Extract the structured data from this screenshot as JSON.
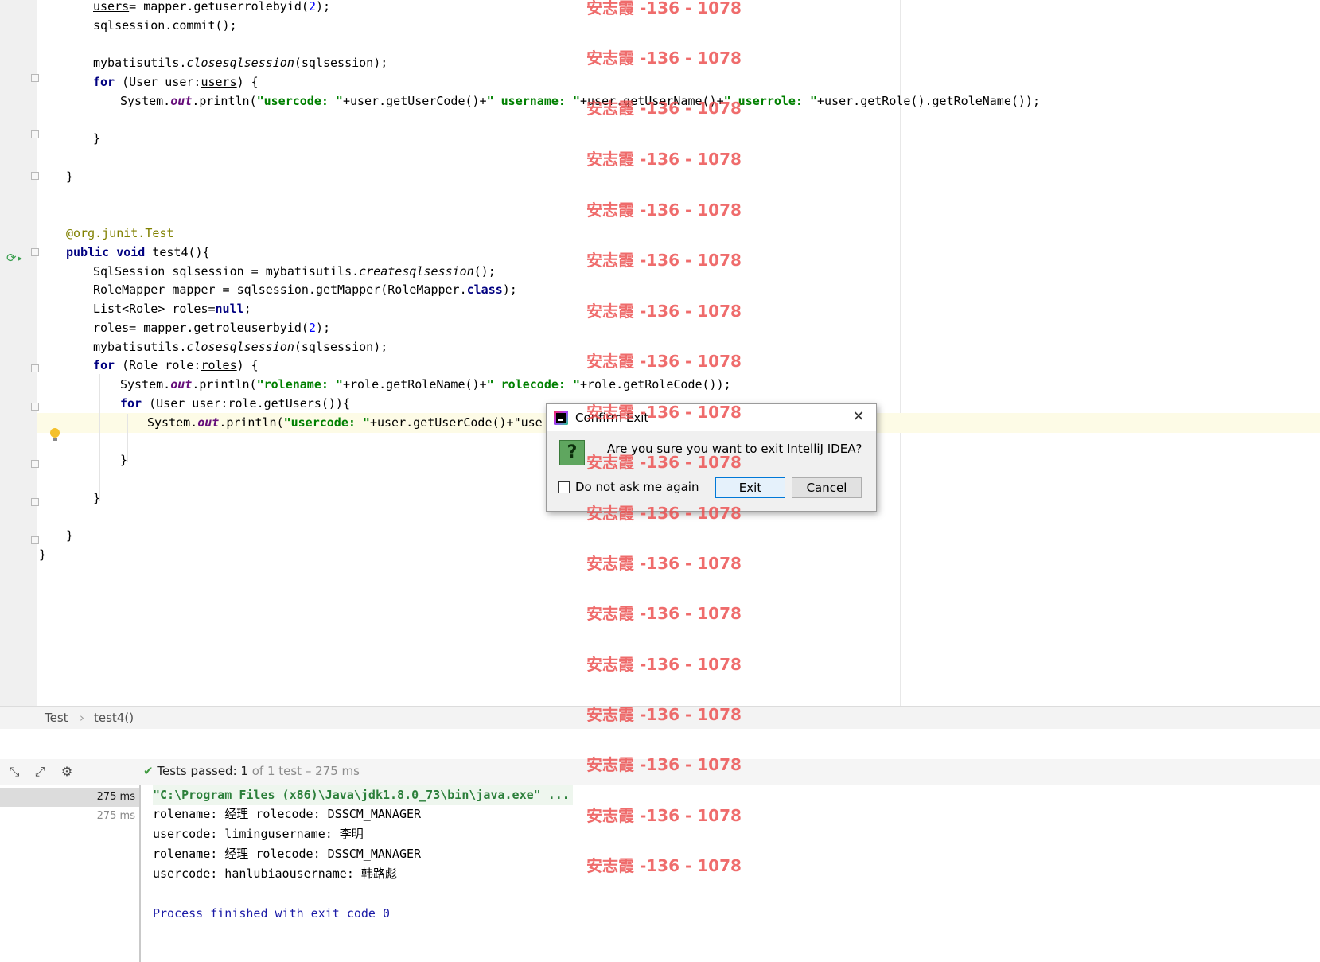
{
  "editor": {
    "lines": [
      [
        {
          "t": "users",
          "c": "ul"
        },
        {
          "t": "= mapper.getuserrolebyid("
        },
        {
          "t": "2",
          "c": "num"
        },
        {
          "t": ");"
        }
      ],
      [
        {
          "t": "sqlsession.commit();"
        }
      ],
      [],
      [
        {
          "t": "mybatisutils."
        },
        {
          "t": "closesqlsession",
          "c": "static"
        },
        {
          "t": "(sqlsession);"
        }
      ],
      [
        {
          "t": "for",
          "c": "kw"
        },
        {
          "t": " (User user:"
        },
        {
          "t": "users",
          "c": "ul"
        },
        {
          "t": ") {"
        }
      ],
      [
        {
          "t": "System."
        },
        {
          "t": "out",
          "c": "field"
        },
        {
          "t": ".println("
        },
        {
          "t": "\"usercode: \"",
          "c": "str"
        },
        {
          "t": "+user.getUserCode()+"
        },
        {
          "t": "\" username: \"",
          "c": "str"
        },
        {
          "t": "+user.getUserName()+"
        },
        {
          "t": "\" userrole: \"",
          "c": "str"
        },
        {
          "t": "+user.getRole().getRoleName());"
        }
      ],
      [],
      [
        {
          "t": "}"
        }
      ],
      [],
      [
        {
          "t": "}"
        }
      ],
      [],
      [],
      [
        {
          "t": "@org.junit.",
          "c": "ann"
        },
        {
          "t": "Test",
          "c": "ann"
        }
      ],
      [
        {
          "t": "public",
          "c": "kw"
        },
        {
          "t": " "
        },
        {
          "t": "void",
          "c": "kw"
        },
        {
          "t": " test4(){"
        }
      ],
      [
        {
          "t": "SqlSession sqlsession = mybatisutils."
        },
        {
          "t": "createsqlsession",
          "c": "static"
        },
        {
          "t": "();"
        }
      ],
      [
        {
          "t": "RoleMapper mapper = sqlsession.getMapper(RoleMapper."
        },
        {
          "t": "class",
          "c": "kw"
        },
        {
          "t": ");"
        }
      ],
      [
        {
          "t": "List<Role> "
        },
        {
          "t": "roles",
          "c": "ul"
        },
        {
          "t": "="
        },
        {
          "t": "null",
          "c": "kw"
        },
        {
          "t": ";"
        }
      ],
      [
        {
          "t": "roles",
          "c": "ul"
        },
        {
          "t": "= mapper.getroleuserbyid("
        },
        {
          "t": "2",
          "c": "num"
        },
        {
          "t": ");"
        }
      ],
      [
        {
          "t": "mybatisutils."
        },
        {
          "t": "closesqlsession",
          "c": "static"
        },
        {
          "t": "(sqlsession);"
        }
      ],
      [
        {
          "t": "for",
          "c": "kw"
        },
        {
          "t": " (Role role:"
        },
        {
          "t": "roles",
          "c": "ul"
        },
        {
          "t": ") {"
        }
      ],
      [
        {
          "t": "System."
        },
        {
          "t": "out",
          "c": "field"
        },
        {
          "t": ".println("
        },
        {
          "t": "\"rolename: \"",
          "c": "str"
        },
        {
          "t": "+role.getRoleName()+"
        },
        {
          "t": "\" rolecode: \"",
          "c": "str"
        },
        {
          "t": "+role.getRoleCode());"
        }
      ],
      [
        {
          "t": "for",
          "c": "kw"
        },
        {
          "t": " (User user:role.getUsers()){"
        }
      ],
      [
        {
          "t": "System."
        },
        {
          "t": "out",
          "c": "field"
        },
        {
          "t": ".println("
        },
        {
          "t": "\"usercode: \"",
          "c": "str"
        },
        {
          "t": "+user.getUserCode()+\"use"
        }
      ],
      [],
      [
        {
          "t": "}"
        }
      ],
      [],
      [
        {
          "t": "}"
        }
      ],
      [],
      [
        {
          "t": "}"
        }
      ],
      [
        {
          "t": "}"
        }
      ]
    ]
  },
  "breadcrumb": {
    "class_name": "Test",
    "separator": "›",
    "method_name": "test4()"
  },
  "test_toolbar": {
    "status_prefix": "Tests passed: ",
    "passed_count": "1",
    "status_suffix": " of 1 test – 275 ms"
  },
  "test_tree": [
    {
      "label": "275 ms",
      "selected": true
    },
    {
      "label": "275 ms",
      "selected": false
    }
  ],
  "console": {
    "command": "\"C:\\Program Files (x86)\\Java\\jdk1.8.0_73\\bin\\java.exe\" ...",
    "output": [
      "rolename: 经理 rolecode: DSSCM_MANAGER",
      "usercode: limingusername: 李明",
      "rolename: 经理 rolecode: DSSCM_MANAGER",
      "usercode: hanlubiaousername: 韩路彪",
      "",
      "Process finished with exit code 0"
    ]
  },
  "dialog": {
    "title": "Confirm Exit",
    "message": "Are you sure you want to exit IntelliJ IDEA?",
    "checkbox_label": "Do not ask me again",
    "exit_label": "Exit",
    "cancel_label": "Cancel",
    "close_glyph": "✕",
    "question_glyph": "?"
  },
  "watermark": {
    "text": "安志霞 -136 - 1078"
  },
  "icons": {
    "run": "run-test-icon",
    "bulb": "intention-bulb-icon",
    "toolbar": [
      "collapse-icon",
      "export-icon",
      "gear-icon"
    ]
  },
  "colors": {
    "keyword": "#000080",
    "string": "#008000",
    "watermark": "#ec4c4c",
    "pass": "#3f9a3f"
  }
}
